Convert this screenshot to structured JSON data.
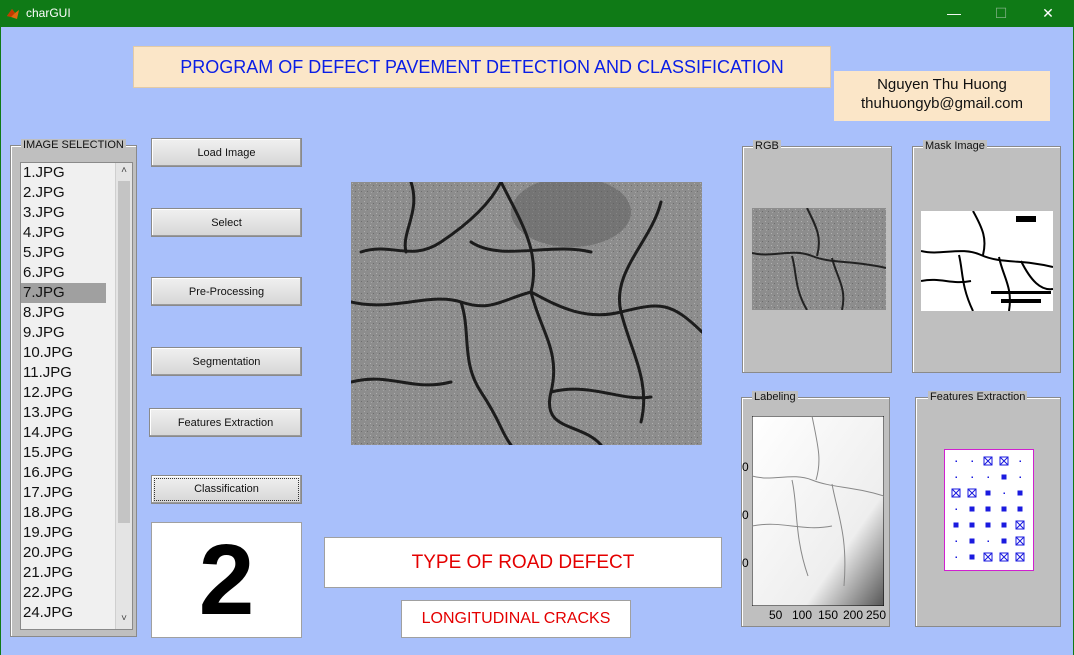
{
  "window": {
    "title": "charGUI",
    "minimize": "—",
    "maximize": "☐",
    "close": "✕"
  },
  "banner": {
    "title": "PROGRAM OF DEFECT PAVEMENT DETECTION AND CLASSIFICATION"
  },
  "author": {
    "name": "Nguyen Thu Huong",
    "email": "thuhuongyb@gmail.com"
  },
  "image_selection": {
    "label": "IMAGE SELECTION",
    "items": [
      "1.JPG",
      "2.JPG",
      "3.JPG",
      "4.JPG",
      "5.JPG",
      "6.JPG",
      "7.JPG",
      "8.JPG",
      "9.JPG",
      "10.JPG",
      "11.JPG",
      "12.JPG",
      "13.JPG",
      "14.JPG",
      "15.JPG",
      "16.JPG",
      "17.JPG",
      "18.JPG",
      "19.JPG",
      "20.JPG",
      "21.JPG",
      "22.JPG",
      "24.JPG"
    ],
    "selected": "7.JPG"
  },
  "buttons": {
    "load": "Load Image",
    "select": "Select",
    "preprocess": "Pre-Processing",
    "segmentation": "Segmentation",
    "features": "Features Extraction",
    "classification": "Classification"
  },
  "result": {
    "class_number": "2",
    "type_heading": "TYPE OF ROAD DEFECT",
    "type_value": "LONGITUDINAL CRACKS"
  },
  "panels": {
    "rgb": "RGB",
    "mask": "Mask Image",
    "labeling": "Labeling",
    "features": "Features Extraction"
  },
  "labeling_axes": {
    "xticks": [
      "50",
      "100",
      "150",
      "200",
      "250"
    ],
    "yticks": [
      "0",
      "0",
      "0"
    ]
  },
  "feature_grid": {
    "rows": [
      [
        ".",
        ".",
        "x",
        "x",
        "."
      ],
      [
        ".",
        ".",
        ".",
        "s",
        "."
      ],
      [
        "x",
        "x",
        "s",
        ".",
        "s"
      ],
      [
        ".",
        "s",
        "s",
        "s",
        "s"
      ],
      [
        "s",
        "s",
        "s",
        "s",
        "x"
      ],
      [
        ".",
        "s",
        ".",
        "s",
        "x"
      ],
      [
        ".",
        "s",
        "x",
        "x",
        "x"
      ]
    ]
  },
  "colors": {
    "background": "#a9c0fb",
    "titlebar": "#0f7a16",
    "banner_text": "#0a1ee6",
    "result_text": "#e40000"
  }
}
